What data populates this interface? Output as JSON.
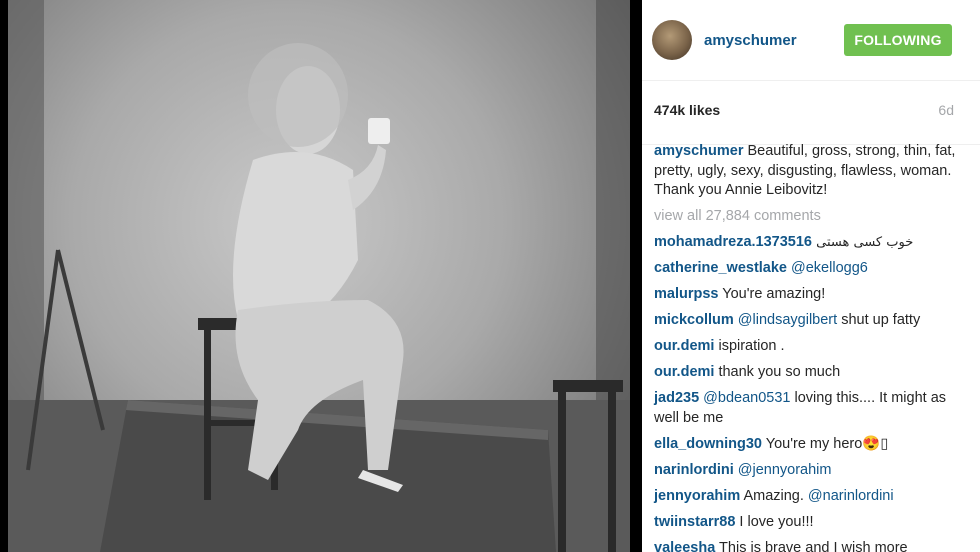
{
  "post": {
    "username": "amyschumer",
    "follow_label": "FOLLOWING",
    "likes": "474k likes",
    "age": "6d",
    "view_all": "view all 27,884 comments"
  },
  "caption": {
    "user": "amyschumer",
    "text": " Beautiful, gross, strong, thin, fat, pretty, ugly, sexy, disgusting, flawless, woman. Thank you Annie Leibovitz!"
  },
  "comments": [
    {
      "user": "mohamadreza.1373516",
      "mention": "",
      "text": " خوب کسی هستی"
    },
    {
      "user": "catherine_westlake",
      "mention": " @ekellogg6",
      "text": ""
    },
    {
      "user": "malurpss",
      "mention": "",
      "text": " You're amazing!"
    },
    {
      "user": "mickcollum",
      "mention": " @lindsaygilbert",
      "text": " shut up fatty"
    },
    {
      "user": "our.demi",
      "mention": "",
      "text": " ispiration ."
    },
    {
      "user": "our.demi",
      "mention": "",
      "text": " thank you so much"
    },
    {
      "user": "jad235",
      "mention": " @bdean0531",
      "text": " loving this.... It might as well be me"
    },
    {
      "user": "ella_downing30",
      "mention": "",
      "text": " You're my hero😍▯"
    },
    {
      "user": "narinlordini",
      "mention": " @jennyorahim",
      "text": ""
    },
    {
      "user": "jennyorahim",
      "mention": "",
      "text": " Amazing. ",
      "mention2": "@narinlordini"
    },
    {
      "user": "twiinstarr88",
      "mention": "",
      "text": " I love you!!!"
    },
    {
      "user": "valeesha",
      "mention": "",
      "text": " This is brave and I wish more"
    }
  ],
  "colors": {
    "link": "#125688",
    "follow_bg": "#70c050",
    "muted": "#a5a7aa"
  }
}
